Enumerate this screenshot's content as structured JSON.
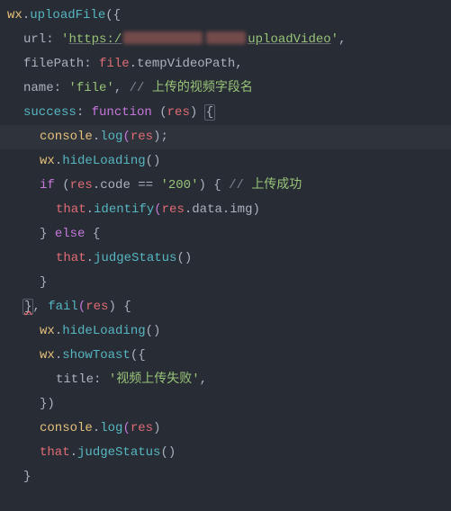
{
  "code": {
    "l1_a": "wx",
    "l1_b": ".",
    "l1_c": "uploadFile",
    "l1_d": "({",
    "l2_a": "url",
    "l2_colon": ": ",
    "l2_q": "'",
    "l2_https": "https:/",
    "l2_upload": "uploadVideo",
    "l2_end": ",",
    "l3_a": "filePath",
    "l3_b": ": ",
    "l3_c": "file",
    "l3_d": ".tempVideoPath,",
    "l4_a": "name",
    "l4_b": ": ",
    "l4_c": "'file'",
    "l4_d": ", ",
    "l4_e": "// ",
    "l4_f": "上传的视频字段名",
    "l5_a": "success",
    "l5_b": ": ",
    "l5_c": "function",
    "l5_d": " (",
    "l5_e": "res",
    "l5_f": ") ",
    "l5_g": "{",
    "l6_a": "console",
    "l6_b": ".",
    "l6_c": "log",
    "l6_d": "(",
    "l6_e": "res",
    "l6_f": ");",
    "l7_a": "wx",
    "l7_b": ".",
    "l7_c": "hideLoading",
    "l7_d": "()",
    "l8_a": "if",
    "l8_b": " (",
    "l8_c": "res",
    "l8_d": ".code == ",
    "l8_e": "'200'",
    "l8_f": ") { ",
    "l8_g": "// ",
    "l8_h": "上传成功",
    "l9_a": "that",
    "l9_b": ".",
    "l9_c": "identify",
    "l9_d": "(",
    "l9_e": "res",
    "l9_f": ".data.img)",
    "l10_a": "} ",
    "l10_b": "else",
    "l10_c": " {",
    "l11_a": "that",
    "l11_b": ".",
    "l11_c": "judgeStatus",
    "l11_d": "()",
    "l12_a": "}",
    "l13_a": "}",
    "l13_b": ", ",
    "l13_c": "fail",
    "l13_d": "(",
    "l13_e": "res",
    "l13_f": ") {",
    "l14_a": "wx",
    "l14_b": ".",
    "l14_c": "hideLoading",
    "l14_d": "()",
    "l15_a": "wx",
    "l15_b": ".",
    "l15_c": "showToast",
    "l15_d": "({",
    "l16_a": "title",
    "l16_b": ": ",
    "l16_c": "'视频上传失败'",
    "l16_d": ",",
    "l17_a": "})",
    "l18_a": "console",
    "l18_b": ".",
    "l18_c": "log",
    "l18_d": "(",
    "l18_e": "res",
    "l18_f": ")",
    "l19_a": "that",
    "l19_b": ".",
    "l19_c": "judgeStatus",
    "l19_d": "()",
    "l20_a": "}"
  }
}
